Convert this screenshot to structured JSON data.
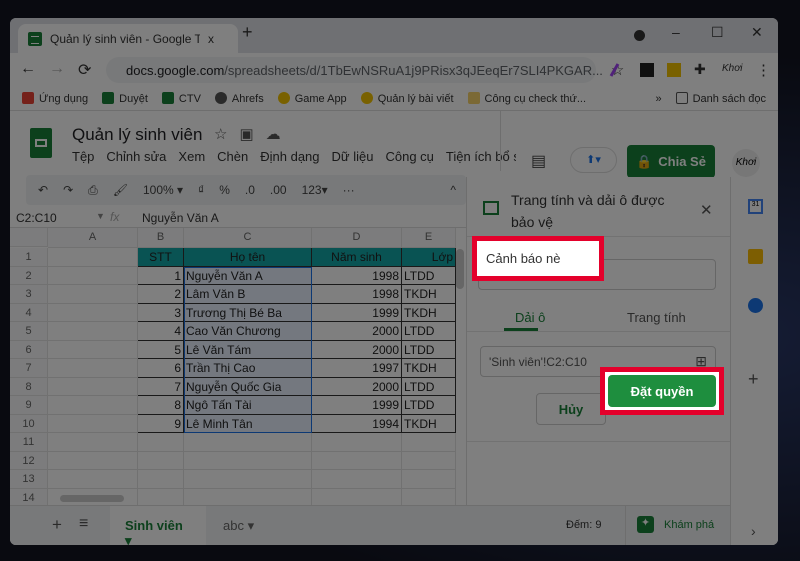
{
  "browser": {
    "tab_title": "Quản lý sinh viên - Google Trang",
    "tab_close": "x",
    "new_tab": "+",
    "minimize": "–",
    "maximize": "☐",
    "close": "✕",
    "back": "←",
    "forward": "→",
    "reload": "⟳",
    "url_host": "docs.google.com",
    "url_path": "/spreadsheets/d/1TbEwNSRuA1j9PRisx3qJEeqEr7SLI4PKGAR...",
    "star": "☆",
    "menu": "⋮",
    "extension_label": "Khơi",
    "bookmarks": [
      {
        "label": "Ứng dụng",
        "color": "#ea4335"
      },
      {
        "label": "Duyệt",
        "color": "#188038"
      },
      {
        "label": "CTV",
        "color": "#188038"
      },
      {
        "label": "Ahrefs",
        "color": "#555555"
      },
      {
        "label": "Game App",
        "color": "#f2c200"
      },
      {
        "label": "Quản lý bài viết",
        "color": "#f2c200"
      },
      {
        "label": "Công cụ check thứ...",
        "color": "#f6d36b"
      }
    ],
    "bookmarks_more": "»",
    "reading_list": "Danh sách đọc"
  },
  "sheets": {
    "title": "Quản lý sinh viên",
    "menu": [
      "Tệp",
      "Chỉnh sửa",
      "Xem",
      "Chèn",
      "Định dạng",
      "Dữ liệu",
      "Công cụ",
      "Tiện ích bổ s"
    ],
    "share_label": "Chia Sẻ",
    "avatar": "Khơi",
    "toolbar": {
      "undo": "↶",
      "redo": "↷",
      "print": "⎙",
      "paint": "🖌",
      "zoom": "100%",
      "currency": "₫",
      "percent": "%",
      "dec_less": ".0",
      "dec_more": ".00",
      "format": "123▾",
      "more": "···",
      "collapse": "^"
    },
    "name_box": "C2:C10",
    "fx": "fx",
    "formula": "Nguyễn Văn A",
    "columns": [
      "A",
      "B",
      "C",
      "D",
      "E"
    ],
    "rows": [
      "1",
      "2",
      "3",
      "4",
      "5",
      "6",
      "7",
      "8",
      "9",
      "10",
      "11",
      "12",
      "13",
      "14"
    ],
    "table_headers": [
      "STT",
      "Họ tên",
      "Năm sinh",
      "Lớp"
    ],
    "table": [
      [
        "1",
        "Nguyễn Văn A",
        "1998",
        "LTDD"
      ],
      [
        "2",
        "Lâm Văn B",
        "1998",
        "TKDH"
      ],
      [
        "3",
        "Trương Thị Bé Ba",
        "1999",
        "TKDH"
      ],
      [
        "4",
        "Cao Văn Chương",
        "2000",
        "LTDD"
      ],
      [
        "5",
        "Lê Văn Tám",
        "2000",
        "LTDD"
      ],
      [
        "6",
        "Trần Thị Cao",
        "1997",
        "TKDH"
      ],
      [
        "7",
        "Nguyễn Quốc Gia",
        "2000",
        "LTDD"
      ],
      [
        "8",
        "Ngô Tấn Tài",
        "1999",
        "LTDD"
      ],
      [
        "9",
        "Lê Minh Tân",
        "1994",
        "TKDH"
      ]
    ],
    "sheet_tabs": [
      "Sinh viên",
      "abc"
    ],
    "add_sheet": "+",
    "all_sheets": "≡",
    "count": "Đếm: 9",
    "explore": "Khám phá"
  },
  "panel": {
    "title": "Trang tính và dải ô được bảo vệ",
    "close": "✕",
    "description_value": "Cảnh báo nè",
    "tabs": [
      "Dải ô",
      "Trang tính"
    ],
    "active_tab": 0,
    "range_value": "'Sinh viên'!C2:C10",
    "cancel": "Hủy",
    "submit": "Đặt quyền"
  },
  "colors": {
    "accent": "#188038",
    "header_fill": "#12a7a7",
    "highlight": "#e4002b"
  }
}
